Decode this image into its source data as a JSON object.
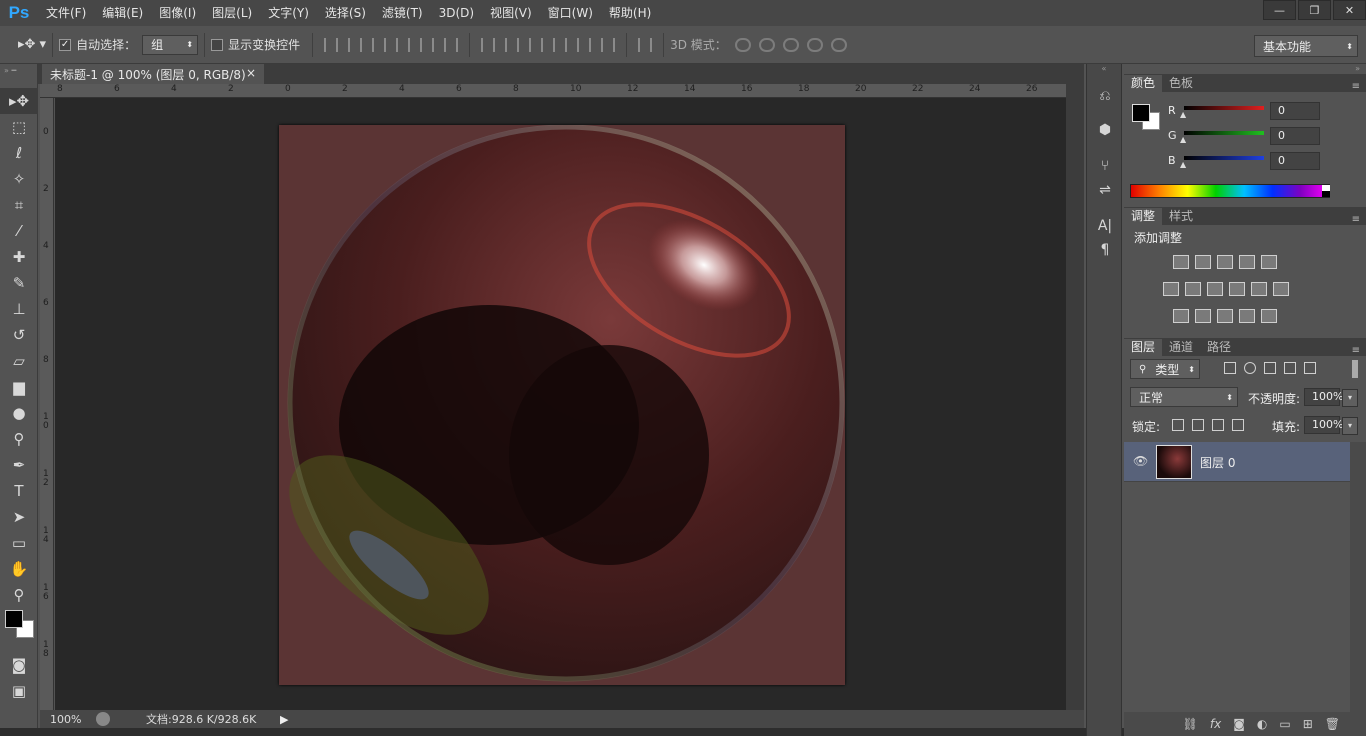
{
  "app": {
    "logo": "Ps"
  },
  "menu": [
    "文件(F)",
    "编辑(E)",
    "图像(I)",
    "图层(L)",
    "文字(Y)",
    "选择(S)",
    "滤镜(T)",
    "3D(D)",
    "视图(V)",
    "窗口(W)",
    "帮助(H)"
  ],
  "window_controls": {
    "minimize": "—",
    "restore": "❐",
    "close": "✕"
  },
  "options": {
    "auto_select_label": "自动选择：",
    "auto_select_value": "组",
    "show_transform_label": "显示变换控件",
    "mode3d_label": "3D 模式：",
    "workspace": "基本功能"
  },
  "document": {
    "tab_title": "未标题-1 @ 100% (图层 0, RGB/8) *",
    "tab_close": "×",
    "hruler_ticks": [
      "8",
      "6",
      "4",
      "2",
      "0",
      "2",
      "4",
      "6",
      "8",
      "10",
      "12",
      "14",
      "16",
      "18",
      "20",
      "22",
      "24",
      "26"
    ],
    "vruler_ticks": [
      "0",
      "2",
      "4",
      "6",
      "8",
      "1 0",
      "1 2",
      "1 4",
      "1 6",
      "1 8"
    ]
  },
  "status": {
    "zoom": "100%",
    "doc_info": "文档:928.6 K/928.6K"
  },
  "color_panel": {
    "tabs": [
      "颜色",
      "色板"
    ],
    "channels": [
      {
        "label": "R",
        "value": "0",
        "color": "#e02020"
      },
      {
        "label": "G",
        "value": "0",
        "color": "#20c020"
      },
      {
        "label": "B",
        "value": "0",
        "color": "#2040e0"
      }
    ]
  },
  "adjust_panel": {
    "tabs": [
      "调整",
      "样式"
    ],
    "title": "添加调整"
  },
  "layers_panel": {
    "tabs": [
      "图层",
      "通道",
      "路径"
    ],
    "filter_kind": "类型",
    "blend_mode": "正常",
    "opacity_label": "不透明度:",
    "opacity_value": "100%",
    "lock_label": "锁定:",
    "fill_label": "填充:",
    "fill_value": "100%",
    "layers": [
      {
        "name": "图层 0",
        "visible": true
      }
    ]
  },
  "colors": {
    "accent_ps": "#31a8ff",
    "panel": "#535353",
    "canvas_bg": "#282828",
    "artboard": "#5b3434",
    "selected_layer": "#58627a"
  }
}
